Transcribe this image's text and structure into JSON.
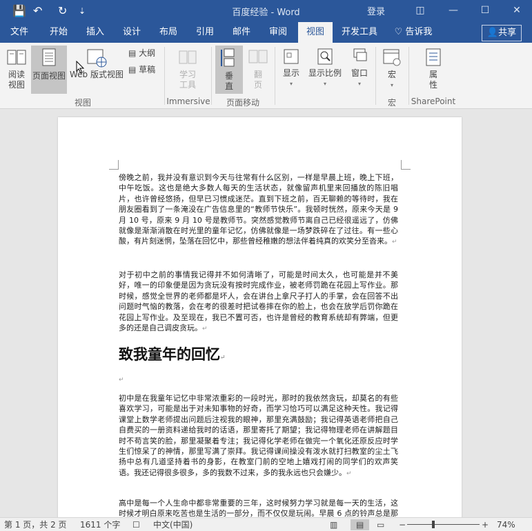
{
  "titlebar": {
    "doc_title": "百度经验 - Word",
    "login": "登录",
    "quick_access": {
      "save": "💾",
      "undo": "↶",
      "redo": "↻",
      "customize": "⇣"
    },
    "window_controls": {
      "restore": "◫",
      "minimize": "—",
      "maximize": "☐",
      "close": "✕"
    }
  },
  "tabs": [
    "文件",
    "开始",
    "插入",
    "设计",
    "布局",
    "引用",
    "邮件",
    "审阅",
    "视图",
    "开发工具"
  ],
  "active_tab": "视图",
  "tell_me": "告诉我",
  "share": "共享",
  "ribbon": {
    "read_mode": "阅读\n视图",
    "print_layout": "页面视图",
    "web_layout": "Web 版式视图",
    "outline": "大纲",
    "draft": "草稿",
    "group_views": "视图",
    "learning_tools": "学习\n工具",
    "group_immersive": "Immersive",
    "vertical": "垂\n直",
    "side_to_side": "翻\n页",
    "group_page_movement": "页面移动",
    "show": "显示",
    "zoom": "显示比例",
    "window": "窗口",
    "macros": "宏",
    "group_macros": "宏",
    "properties": "属\n性",
    "group_sharepoint": "SharePoint"
  },
  "document": {
    "para1": "傍晚之前，我并没有意识到今天与往常有什么区别，一样是早晨上班，晚上下班，中午吃饭。这也是绝大多数人每天的生活状态，就像留声机里来回播放的陈旧唱片，也许曾经悠扬，但早已习惯成迷茫。直到下班之前，百无聊赖的等待时，我在朋友圈看到了一条淹没在广告信息里的“教师节快乐”。我顿时恍然，原来今天是 9 月 10 号，原来 9 月 10 号是教师节。突然感觉教师节离自己已经很遥远了，仿佛就像是渐渐消散在时光里的童年记忆，仿佛就像是一场梦跌碎在了过往。有一些心酸，有片刻迷惘，坠落在回忆中，那些曾经稚嫩的想法伴着纯真的欢笑分至沓来。",
    "para2": "对于初中之前的事情我记得并不如何清晰了，可能是时间太久，也可能是并不美好，唯一的印象便是因为贪玩没有按时完成作业，被老师罚跪在花园上写作业。那时候，感觉全世界的老师都是坏人，会在讲台上拿尺子打人的手掌，会在回答不出问题时气恼的教落，会在考的很差时把试卷摔在你的脸上，也会在放学后罚你跪在花园上写作业。及至现在，我已不置可否，也许是曾经的教育系统却有弊端，但更多的还是自己调皮贪玩。",
    "heading": "致我童年的回忆",
    "para3": "初中是在我童年记忆中非常浓重彩的一段时光，那时的我依然贪玩，却莫名的有些喜欢学习，可能是出于对未知事物的好奇，而学习恰巧可以满足这种天性。我记得课堂上数学老师提出问题后注视我的眼神，那里充满鼓励；我记得英语老师把自己自费买的一册资料递给我时的话语，那里寄托了期望；我记得物理老师在讲解题目时不苟言笑的脸，那里凝聚着专注；我记得化学老师在做完一个氧化还原反应时学生们惊呆了的神情，那里写满了崇拜。我记得课间操没有泼水就打扫教室的尘土飞扬中总有几道坚持着书的身影，在教室门前的空地上嬉戏打闹的同学们的欢声笑语。我还记得很多很多，多的我数不过来，多的我永远也只会嫌少。",
    "para4": "高中是每一个人生命中都非常重要的三年，这时候努力学习就是每一天的生活，这时候才明白原来吃苦也是生活的一部分，而不仅仅是玩闹。早晨 6 点的铃声总是那么刺耳的把我从梦境中拽出来，踏着晨露，披着渐渐消散的夜幕"
  },
  "status": {
    "page": "第 1 页，共 2 页",
    "words": "1611 个字",
    "language": "中文(中国)",
    "zoom": "74%",
    "zoom_minus": "−",
    "zoom_plus": "+"
  }
}
